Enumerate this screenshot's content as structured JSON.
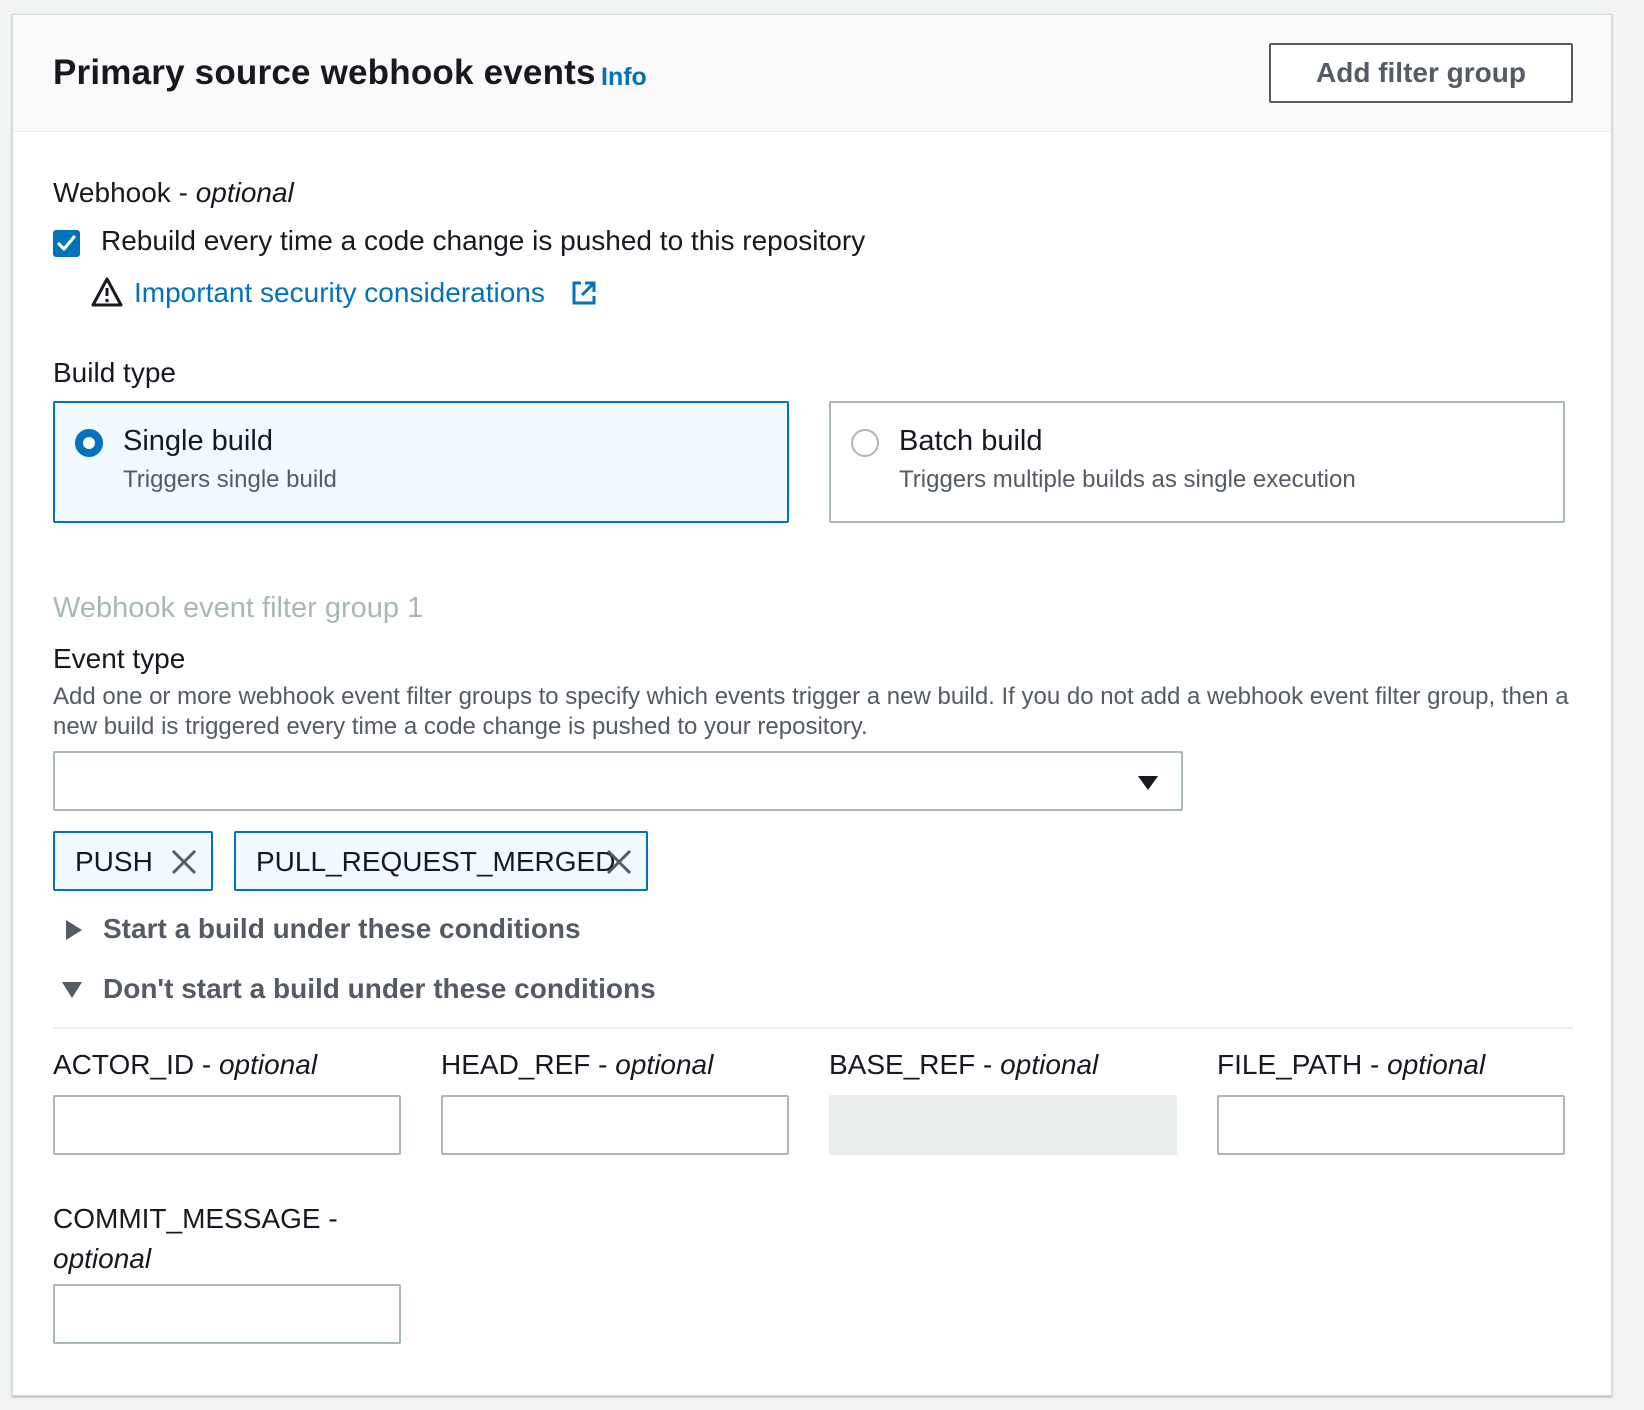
{
  "header": {
    "title": "Primary source webhook events",
    "info_label": "Info",
    "add_button_label": "Add filter group"
  },
  "webhook": {
    "label": "Webhook",
    "label_sep": " - ",
    "optional": "optional",
    "checkbox_label": "Rebuild every time a code change is pushed to this repository",
    "checkbox_checked": true,
    "security_link": "Important security considerations",
    "warning_icon": "warning-icon",
    "external_icon": "external-link-icon"
  },
  "build_type": {
    "label": "Build type",
    "options": [
      {
        "title": "Single build",
        "description": "Triggers single build",
        "selected": true
      },
      {
        "title": "Batch build",
        "description": "Triggers multiple builds as single execution",
        "selected": false
      }
    ]
  },
  "filter_group": {
    "heading": "Webhook event filter group 1",
    "event_type_label": "Event type",
    "event_type_description": "Add one or more webhook event filter groups to specify which events trigger a new build. If you do not add a webhook event filter group, then a new build is triggered every time a code change is pushed to your repository.",
    "select_value": "",
    "tokens": [
      "PUSH",
      "PULL_REQUEST_MERGED"
    ],
    "start_conditions_label": "Start a build under these conditions",
    "start_conditions_expanded": false,
    "dont_start_conditions_label": "Don't start a build under these conditions",
    "dont_start_conditions_expanded": true
  },
  "conditions": {
    "optional": "optional",
    "fields": [
      {
        "name": "ACTOR_ID",
        "value": "",
        "disabled": false
      },
      {
        "name": "HEAD_REF",
        "value": "",
        "disabled": false
      },
      {
        "name": "BASE_REF",
        "value": "",
        "disabled": true
      },
      {
        "name": "FILE_PATH",
        "value": "",
        "disabled": false
      },
      {
        "name": "COMMIT_MESSAGE",
        "value": "",
        "disabled": false
      }
    ]
  },
  "colors": {
    "accent": "#0073bb",
    "text": "#16191f",
    "secondary_text": "#545b64",
    "border": "#aab7b8",
    "disabled_fill": "#eaeded"
  }
}
